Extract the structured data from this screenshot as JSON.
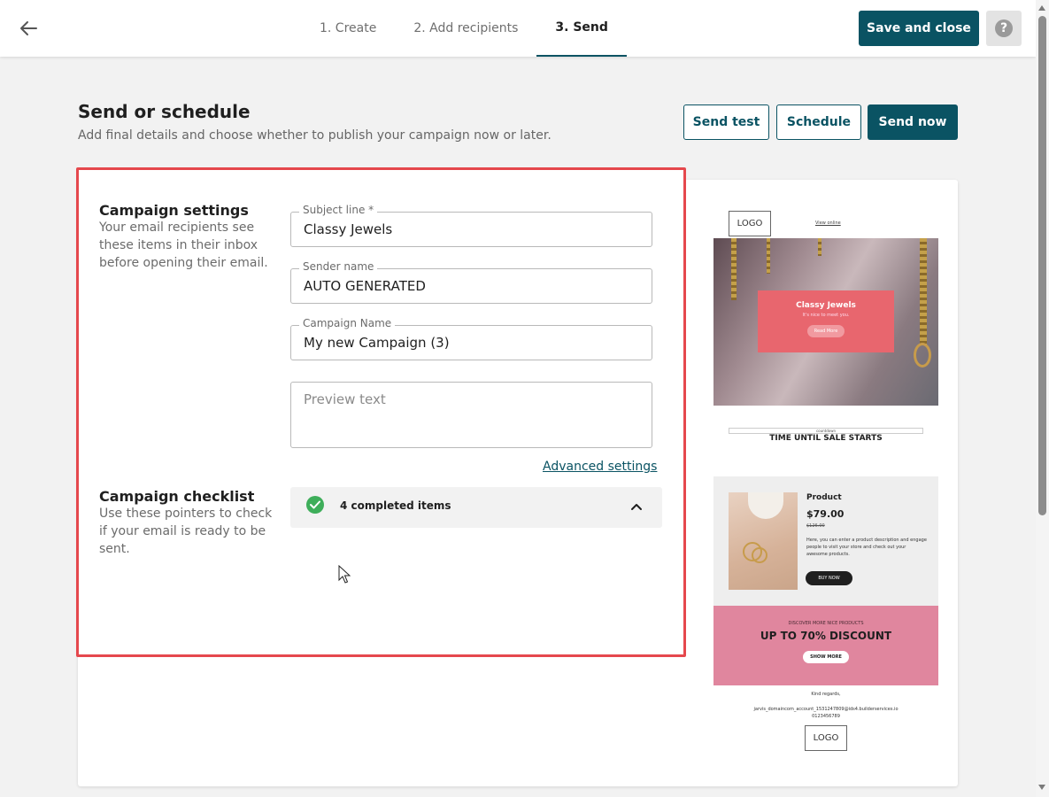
{
  "topbar": {
    "steps": [
      "1. Create",
      "2. Add recipients",
      "3. Send"
    ],
    "active_step": 2,
    "save_close_label": "Save and close",
    "help_symbol": "?"
  },
  "header": {
    "title": "Send or schedule",
    "subtitle": "Add final details and choose whether to publish your campaign now or later.",
    "send_test_label": "Send test",
    "schedule_label": "Schedule",
    "send_now_label": "Send now"
  },
  "settings": {
    "title": "Campaign settings",
    "description": "Your email recipients see these items in their inbox before opening their email.",
    "subject_label": "Subject line *",
    "subject_value": "Classy Jewels",
    "sender_label": "Sender name",
    "sender_value": "AUTO GENERATED",
    "campaign_label": "Campaign Name",
    "campaign_value": "My new Campaign (3)",
    "preview_placeholder": "Preview text",
    "advanced_link": "Advanced settings"
  },
  "checklist": {
    "title": "Campaign checklist",
    "description": "Use these pointers to check if your email is ready to be sent.",
    "completed_text": "4 completed items"
  },
  "preview": {
    "logo_top": "LOGO",
    "view_online": "View online",
    "hero_title": "Classy Jewels",
    "hero_subtitle": "It's nice to meet you.",
    "hero_button": "Read More",
    "countdown_alt": "countdown",
    "countdown_title": "TIME UNTIL SALE STARTS",
    "product_name": "Product",
    "product_price": "$79.00",
    "product_old_price": "$126.00",
    "product_desc": "Here, you can enter a product description and engage people to visit your store and check out your awesome products.",
    "buy_button": "BUY NOW",
    "discount_subtitle": "DISCOVER MORE NICE PRODUCTS",
    "discount_title": "UP TO 70% DISCOUNT",
    "show_more": "SHOW MORE",
    "regards": "Kind regards,",
    "email": "jarvis_domaincom_account_1531247809@ids4.builderservices.io",
    "phone": "0123456789",
    "logo_bottom": "LOGO"
  },
  "colors": {
    "accent": "#0a5363",
    "highlight_border": "#e5484d",
    "check_green": "#3eae5a",
    "hero_card": "#e8666e",
    "discount_bg": "#e0869e"
  }
}
